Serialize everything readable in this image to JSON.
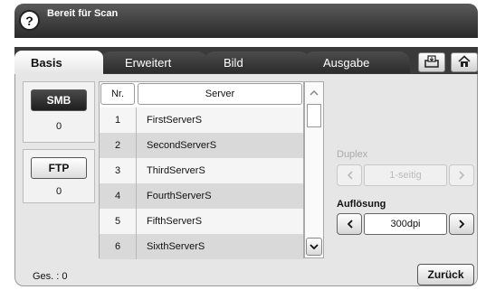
{
  "title": "Bereit für Scan",
  "help_icon": "?",
  "tabs": [
    {
      "label": "Basis"
    },
    {
      "label": "Erweitert"
    },
    {
      "label": "Bild"
    },
    {
      "label": "Ausgabe"
    }
  ],
  "toolbar": {
    "icons": [
      "tray-icon",
      "home-icon"
    ]
  },
  "sidebar": {
    "smb": {
      "label": "SMB",
      "count": "0"
    },
    "ftp": {
      "label": "FTP",
      "count": "0"
    }
  },
  "table": {
    "headers": {
      "nr": "Nr.",
      "server": "Server"
    },
    "rows": [
      {
        "nr": "1",
        "server": "FirstServerS"
      },
      {
        "nr": "2",
        "server": "SecondServerS"
      },
      {
        "nr": "3",
        "server": "ThirdServerS"
      },
      {
        "nr": "4",
        "server": "FourthServerS"
      },
      {
        "nr": "5",
        "server": "FifthServerS"
      },
      {
        "nr": "6",
        "server": "SixthServerS"
      }
    ]
  },
  "duplex": {
    "label": "Duplex",
    "value": "1-seitig",
    "enabled": false
  },
  "aufloesung": {
    "label": "Auflösung",
    "value": "300dpi"
  },
  "footer": {
    "total": "Ges. : 0",
    "back_label": "Zurück"
  },
  "colors": {
    "titlebar": "#3a3a3a",
    "panel": "#e6e6e6",
    "row_alt": "#d9d9d9"
  }
}
